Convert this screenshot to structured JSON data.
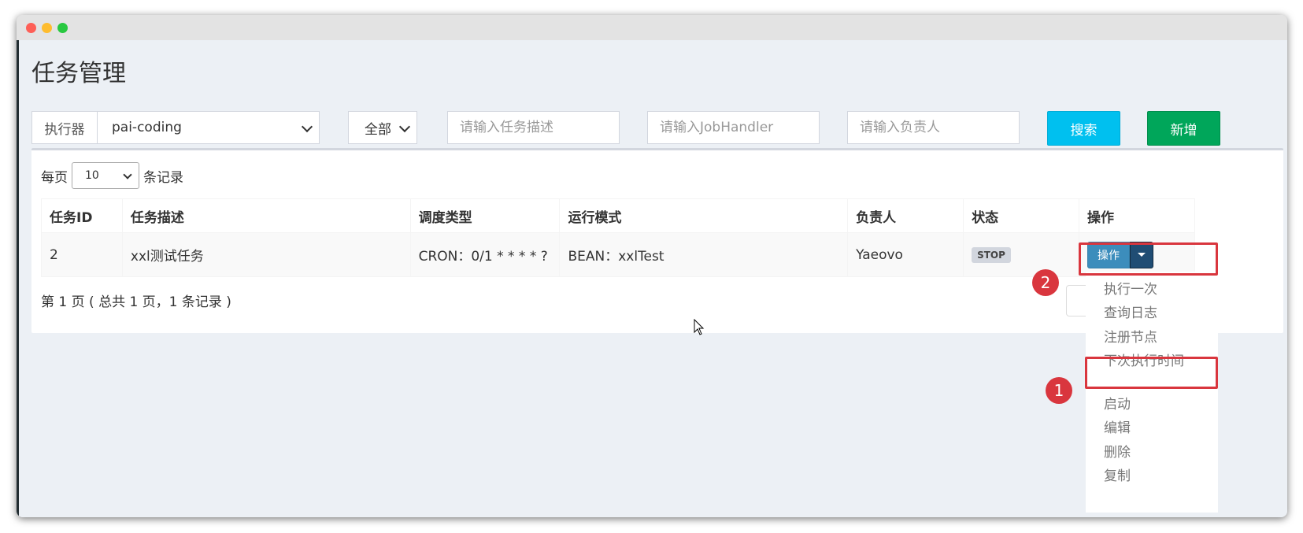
{
  "page": {
    "title": "任务管理"
  },
  "filters": {
    "executor_label": "执行器",
    "executor_value": "pai-coding",
    "status_value": "全部",
    "desc_placeholder": "请输入任务描述",
    "handler_placeholder": "请输入JobHandler",
    "author_placeholder": "请输入负责人",
    "search_label": "搜索",
    "add_label": "新增"
  },
  "table": {
    "length_prefix": "每页",
    "length_value": "10",
    "length_suffix": "条记录",
    "headers": [
      "任务ID",
      "任务描述",
      "调度类型",
      "运行模式",
      "负责人",
      "状态",
      "操作"
    ],
    "rows": [
      {
        "id": "2",
        "desc": "xxl测试任务",
        "schedule": "CRON：0/1 * * * * ?",
        "mode": "BEAN：xxlTest",
        "author": "Yaeovo",
        "status": "STOP",
        "op_label": "操作"
      }
    ],
    "pager_info": "第 1 页 ( 总共 1 页，1 条记录 )"
  },
  "dropdown": {
    "items": [
      "执行一次",
      "查询日志",
      "注册节点",
      "下次执行时间",
      "启动",
      "编辑",
      "删除",
      "复制"
    ]
  },
  "annotations": {
    "marker_1": "1",
    "marker_2": "2",
    "color": "#d9363e"
  },
  "colors": {
    "search": "#00c0ef",
    "add": "#00a65a",
    "primary": "#3c8dbc"
  }
}
